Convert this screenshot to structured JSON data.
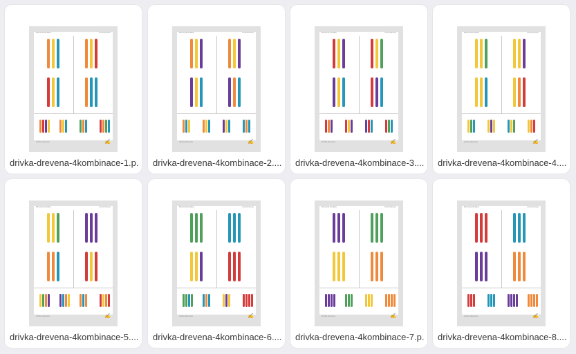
{
  "colors": {
    "red": "#d43b3b",
    "orange": "#ef8a3c",
    "yellow": "#f3c73a",
    "green": "#4fa05a",
    "teal": "#2596b8",
    "purple": "#6a3d9a"
  },
  "files": [
    {
      "name": "drivka-drevena-4kombinace-1.p...",
      "header_left": "Dřevěná Hračka",
      "header_right": "4 kombinace",
      "footer_left": "drivka-drevena",
      "signature": "Signed",
      "quads": [
        [
          "orange",
          "yellow",
          "teal"
        ],
        [
          "orange",
          "yellow",
          "red"
        ],
        [
          "red",
          "yellow",
          "teal"
        ],
        [
          "orange",
          "teal",
          "teal"
        ]
      ],
      "bottom": [
        [
          "orange",
          "red",
          "purple",
          "yellow"
        ],
        [
          "orange",
          "yellow",
          "teal"
        ],
        [
          "green",
          "orange",
          "teal"
        ],
        [
          "red",
          "orange",
          "green",
          "teal"
        ]
      ]
    },
    {
      "name": "drivka-drevena-4kombinace-2....",
      "header_left": "Dřevěná Hračka",
      "header_right": "4 kombinace",
      "footer_left": "drivka-drevena",
      "signature": "Signed",
      "quads": [
        [
          "orange",
          "yellow",
          "purple"
        ],
        [
          "orange",
          "yellow",
          "purple"
        ],
        [
          "purple",
          "yellow",
          "teal"
        ],
        [
          "purple",
          "orange",
          "teal"
        ]
      ],
      "bottom": [
        [
          "orange",
          "teal",
          "yellow"
        ],
        [
          "orange",
          "yellow",
          "teal"
        ],
        [
          "purple",
          "yellow",
          "teal"
        ],
        [
          "teal",
          "orange",
          "teal"
        ]
      ]
    },
    {
      "name": "drivka-drevena-4kombinace-3....",
      "header_left": "Dřevěná Hračka",
      "header_right": "4 kombinace",
      "footer_left": "drivka-drevena",
      "signature": "Signed",
      "quads": [
        [
          "red",
          "yellow",
          "purple"
        ],
        [
          "red",
          "yellow",
          "green"
        ],
        [
          "purple",
          "yellow",
          "teal"
        ],
        [
          "red",
          "purple",
          "teal"
        ]
      ],
      "bottom": [
        [
          "red",
          "orange",
          "purple"
        ],
        [
          "red",
          "yellow",
          "purple"
        ],
        [
          "purple",
          "red",
          "teal"
        ],
        [
          "red",
          "green",
          "teal"
        ]
      ]
    },
    {
      "name": "drivka-drevena-4kombinace-4....",
      "header_left": "Dřevěná Hračka",
      "header_right": "4 kombinace",
      "footer_left": "drivka-drevena",
      "signature": "Signed",
      "quads": [
        [
          "yellow",
          "yellow",
          "green"
        ],
        [
          "yellow",
          "yellow",
          "purple"
        ],
        [
          "yellow",
          "yellow",
          "teal"
        ],
        [
          "yellow",
          "orange",
          "red"
        ]
      ],
      "bottom": [
        [
          "yellow",
          "green",
          "teal"
        ],
        [
          "yellow",
          "purple",
          "yellow"
        ],
        [
          "teal",
          "yellow",
          "green"
        ],
        [
          "yellow",
          "orange",
          "red"
        ]
      ]
    },
    {
      "name": "drivka-drevena-4kombinace-5....",
      "header_left": "Dřevěná Hračka",
      "header_right": "4 kombinace",
      "footer_left": "drivka-drevena",
      "signature": "Signed",
      "quads": [
        [
          "yellow",
          "yellow",
          "green"
        ],
        [
          "purple",
          "purple",
          "purple"
        ],
        [
          "orange",
          "orange",
          "teal"
        ],
        [
          "red",
          "yellow",
          "red"
        ]
      ],
      "bottom": [
        [
          "yellow",
          "green",
          "orange",
          "purple"
        ],
        [
          "purple",
          "teal",
          "orange",
          "yellow"
        ],
        [
          "orange",
          "teal",
          "orange"
        ],
        [
          "red",
          "yellow",
          "orange",
          "red"
        ]
      ]
    },
    {
      "name": "drivka-drevena-4kombinace-6....",
      "header_left": "Dřevěná Hračka",
      "header_right": "4 kombinace",
      "footer_left": "drivka-drevena",
      "signature": "Signed",
      "quads": [
        [
          "green",
          "green",
          "green"
        ],
        [
          "teal",
          "teal",
          "teal"
        ],
        [
          "yellow",
          "yellow",
          "purple"
        ],
        [
          "red",
          "red",
          "red"
        ]
      ],
      "bottom": [
        [
          "green",
          "green",
          "teal",
          "green"
        ],
        [
          "teal",
          "orange",
          "teal"
        ],
        [
          "yellow",
          "purple",
          "yellow"
        ],
        [
          "red",
          "red",
          "red",
          "red"
        ]
      ]
    },
    {
      "name": "drivka-drevena-4kombinace-7.p...",
      "header_left": "Dřevěná Hračka",
      "header_right": "4 kombinace",
      "footer_left": "drivka-drevena",
      "signature": "Signed",
      "quads": [
        [
          "purple",
          "purple",
          "purple"
        ],
        [
          "green",
          "green",
          "green"
        ],
        [
          "yellow",
          "yellow",
          "yellow"
        ],
        [
          "orange",
          "orange",
          "orange"
        ]
      ],
      "bottom": [
        [
          "purple",
          "purple",
          "purple",
          "purple"
        ],
        [
          "green",
          "green",
          "green"
        ],
        [
          "yellow",
          "yellow",
          "yellow"
        ],
        [
          "orange",
          "orange",
          "orange",
          "orange"
        ]
      ]
    },
    {
      "name": "drivka-drevena-4kombinace-8....",
      "header_left": "Dřevěná Hračka",
      "header_right": "4 kombinace",
      "footer_left": "drivka-drevena",
      "signature": "Signed",
      "quads": [
        [
          "red",
          "red",
          "red"
        ],
        [
          "teal",
          "teal",
          "teal"
        ],
        [
          "purple",
          "purple",
          "purple"
        ],
        [
          "orange",
          "orange",
          "orange"
        ]
      ],
      "bottom": [
        [
          "red",
          "red",
          "red"
        ],
        [
          "teal",
          "teal",
          "teal"
        ],
        [
          "purple",
          "purple",
          "purple",
          "purple"
        ],
        [
          "orange",
          "orange",
          "orange",
          "orange"
        ]
      ]
    }
  ]
}
